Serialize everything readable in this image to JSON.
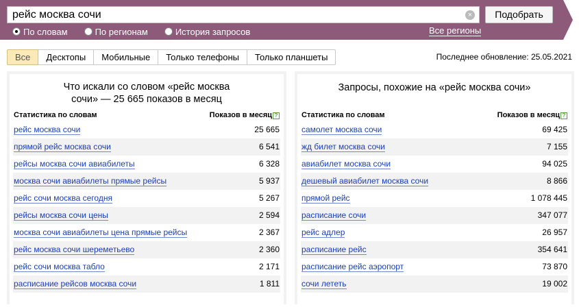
{
  "search": {
    "value": "рейс москва сочи",
    "button_label": "Подобрать"
  },
  "modes": [
    {
      "label": "По словам",
      "selected": true
    },
    {
      "label": "По регионам",
      "selected": false
    },
    {
      "label": "История запросов",
      "selected": false
    }
  ],
  "all_regions_label": "Все регионы",
  "tabs": [
    {
      "label": "Все",
      "active": true
    },
    {
      "label": "Десктопы",
      "active": false
    },
    {
      "label": "Мобильные",
      "active": false
    },
    {
      "label": "Только телефоны",
      "active": false
    },
    {
      "label": "Только планшеты",
      "active": false
    }
  ],
  "last_update": "Последнее обновление: 25.05.2021",
  "left_panel": {
    "title_line1": "Что искали со словом «рейс москва",
    "title_line2": "сочи» — 25 665 показов в месяц",
    "col_words": "Статистика по словам",
    "col_shows": "Показов в месяц",
    "rows": [
      {
        "q": "рейс москва сочи",
        "n": "25 665"
      },
      {
        "q": "прямой рейс москва сочи",
        "n": "6 541"
      },
      {
        "q": "рейсы москва сочи авиабилеты",
        "n": "6 328"
      },
      {
        "q": "москва сочи авиабилеты прямые рейсы",
        "n": "5 937"
      },
      {
        "q": "рейс сочи москва сегодня",
        "n": "5 267"
      },
      {
        "q": "рейсы москва сочи цены",
        "n": "2 594"
      },
      {
        "q": "москва сочи авиабилеты цена прямые рейсы",
        "n": "2 367"
      },
      {
        "q": "рейс москва сочи шереметьево",
        "n": "2 360"
      },
      {
        "q": "рейс сочи москва табло",
        "n": "2 171"
      },
      {
        "q": "расписание рейсов москва сочи",
        "n": "1 811"
      }
    ]
  },
  "right_panel": {
    "title": "Запросы, похожие на «рейс москва сочи»",
    "col_words": "Статистика по словам",
    "col_shows": "Показов в месяц",
    "rows": [
      {
        "q": "самолет москва сочи",
        "n": "69 425"
      },
      {
        "q": "жд билет москва сочи",
        "n": "7 155"
      },
      {
        "q": "авиабилет москва сочи",
        "n": "94 025"
      },
      {
        "q": "дешевый авиабилет москва сочи",
        "n": "8 866"
      },
      {
        "q": "прямой рейс",
        "n": "1 078 445"
      },
      {
        "q": "расписание сочи",
        "n": "347 077"
      },
      {
        "q": "рейс адлер",
        "n": "26 957"
      },
      {
        "q": "расписание рейс",
        "n": "354 641"
      },
      {
        "q": "расписание рейс аэропорт",
        "n": "73 870"
      },
      {
        "q": "сочи лететь",
        "n": "19 002"
      }
    ]
  },
  "colors": {
    "header_bg": "#8e5a79",
    "link": "#1a3dc1",
    "active_tab": "#fbe9b7"
  }
}
